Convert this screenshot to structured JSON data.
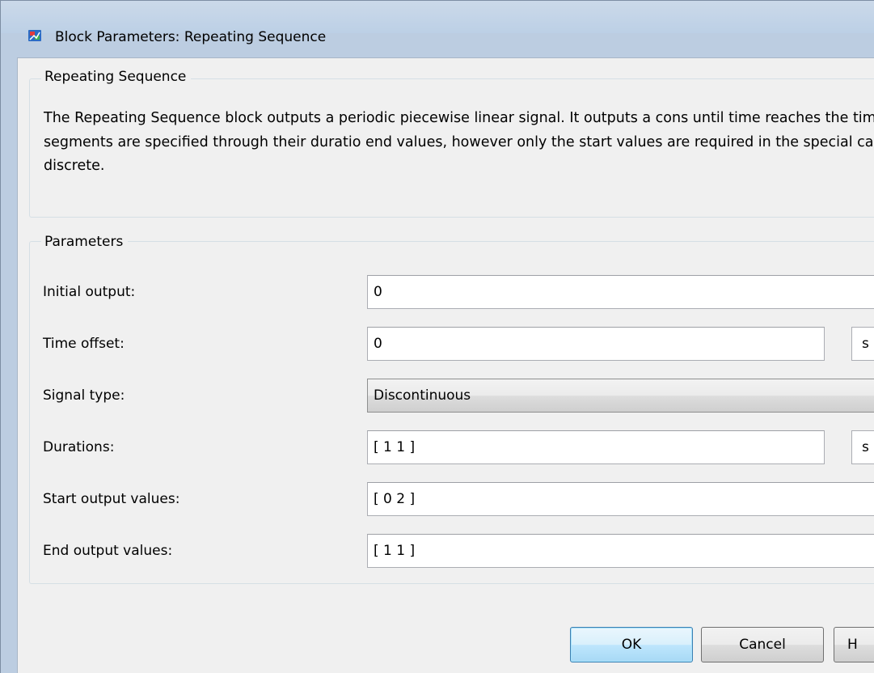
{
  "window": {
    "title": "Block Parameters: Repeating Sequence"
  },
  "description_group": {
    "legend": "Repeating Sequence",
    "text": "The Repeating Sequence block outputs a periodic piecewise linear signal. It outputs a cons until time reaches the time offset. The linear segments are specified through their duratio end values, however only the start values are required in the special cases where the sign discrete."
  },
  "parameters_group": {
    "legend": "Parameters",
    "initial_output": {
      "label": "Initial output:",
      "value": "0"
    },
    "time_offset": {
      "label": "Time offset:",
      "value": "0",
      "unit": "s"
    },
    "signal_type": {
      "label": "Signal type:",
      "value": "Discontinuous"
    },
    "durations": {
      "label": "Durations:",
      "value": "[ 1 1 ]",
      "unit": "s"
    },
    "start_output_values": {
      "label": "Start output values:",
      "value": "[ 0 2 ]"
    },
    "end_output_values": {
      "label": "End output values:",
      "value": "[ 1 1 ]"
    }
  },
  "buttons": {
    "ok": "OK",
    "cancel": "Cancel",
    "help": "H"
  }
}
